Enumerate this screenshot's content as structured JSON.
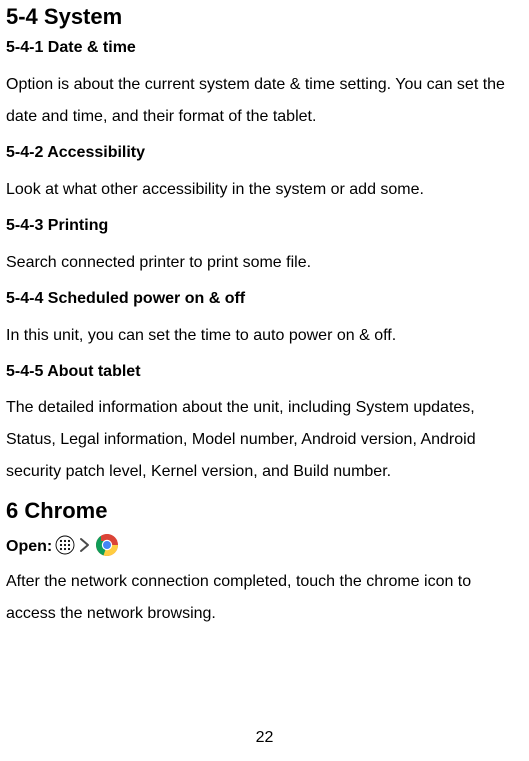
{
  "section54": {
    "title": "5-4 System",
    "items": [
      {
        "heading": "5-4-1 Date & time",
        "body": "Option is about the current system date & time setting. You can set the date and time, and their format of the tablet."
      },
      {
        "heading": "5-4-2 Accessibility",
        "body": "Look at what other accessibility in the system or add some."
      },
      {
        "heading": "5-4-3 Printing",
        "body": "Search connected printer to print some file."
      },
      {
        "heading": "5-4-4 Scheduled power on & off",
        "body": "In this unit, you can set the time to auto power on & off."
      },
      {
        "heading": "5-4-5 About tablet",
        "body": "The detailed information about the unit, including System updates, Status, Legal information, Model number, Android version, Android security patch level, Kernel version, and Build number."
      }
    ]
  },
  "section6": {
    "title": "6 Chrome",
    "open_label": "Open:",
    "body": "After the network connection completed, touch the chrome icon to access the network browsing."
  },
  "page_number": "22"
}
